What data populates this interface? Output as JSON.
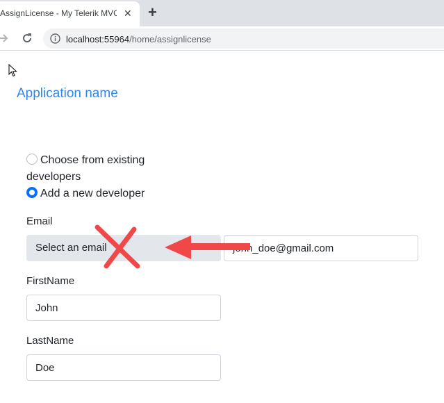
{
  "browser": {
    "tab_title": "AssignLicense - My Telerik MVC A",
    "url_host": "localhost:55964",
    "url_path": "/home/assignlicense"
  },
  "page": {
    "app_name": "Application name",
    "radio_existing_line1": "Choose from existing",
    "radio_existing_line2": "developers",
    "radio_new": "Add a new developer",
    "email_label": "Email",
    "email_select_text": "Select an email",
    "email_input_value": "john_doe@gmail.com",
    "firstname_label": "FirstName",
    "firstname_value": "John",
    "lastname_label": "LastName",
    "lastname_value": "Doe"
  },
  "annotation": {
    "color": "#f04848"
  }
}
